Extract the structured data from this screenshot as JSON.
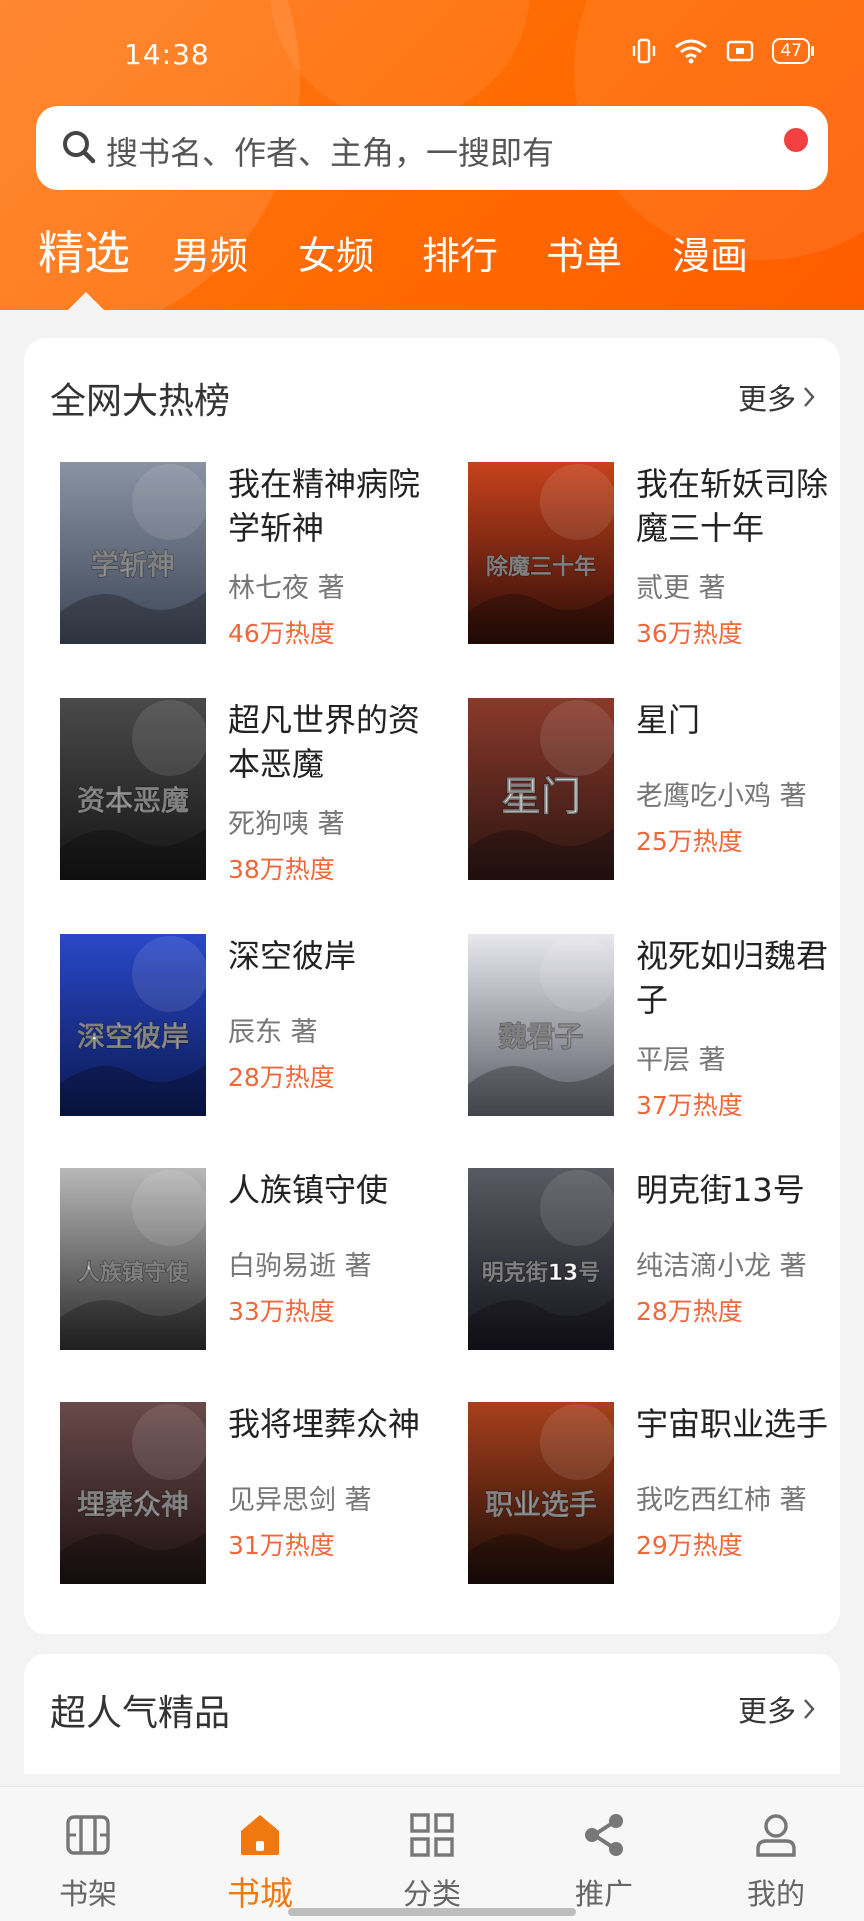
{
  "status_bar": {
    "time": "14:38",
    "battery": "47"
  },
  "search": {
    "placeholder": "搜书名、作者、主角，一搜即有"
  },
  "tabs": [
    "精选",
    "男频",
    "女频",
    "排行",
    "书单",
    "漫画"
  ],
  "active_tab": "精选",
  "hot_section": {
    "title": "全网大热榜",
    "more": "更多",
    "books": [
      {
        "title": "我在精神病院学斩神",
        "author": "林七夜 著",
        "heat": "46万热度",
        "cover_text": "学斩神",
        "cover_colors": [
          "#8a93a3",
          "#3c4656"
        ]
      },
      {
        "title": "我在斩妖司除魔三十年",
        "author": "贰更 著",
        "heat": "36万热度",
        "cover_text": "除魔三十年",
        "cover_colors": [
          "#c8421c",
          "#2a0c08"
        ]
      },
      {
        "title": "超凡世界的资本恶魔",
        "author": "死狗咦 著",
        "heat": "38万热度",
        "cover_text": "资本恶魔",
        "cover_colors": [
          "#4a4a4a",
          "#141414"
        ]
      },
      {
        "title": "星门",
        "author": "老鹰吃小鸡 著",
        "heat": "25万热度",
        "cover_text": "星门",
        "cover_colors": [
          "#8a3a2a",
          "#2a1412"
        ]
      },
      {
        "title": "深空彼岸",
        "author": "辰东 著",
        "heat": "28万热度",
        "cover_text": "深空彼岸",
        "cover_colors": [
          "#2a48c8",
          "#0a1850"
        ]
      },
      {
        "title": "视死如归魏君子",
        "author": "平层 著",
        "heat": "37万热度",
        "cover_text": "魏君子",
        "cover_colors": [
          "#e8e8ee",
          "#5a5a66"
        ]
      },
      {
        "title": "人族镇守使",
        "author": "白驹易逝 著",
        "heat": "33万热度",
        "cover_text": "人族镇守使",
        "cover_colors": [
          "#b8b8b8",
          "#2a2a2a"
        ]
      },
      {
        "title": "明克街13号",
        "author": "纯洁滴小龙 著",
        "heat": "28万热度",
        "cover_text": "明克街13号",
        "cover_colors": [
          "#5a5a64",
          "#14141c"
        ]
      },
      {
        "title": "我将埋葬众神",
        "author": "见异思剑 著",
        "heat": "31万热度",
        "cover_text": "埋葬众神",
        "cover_colors": [
          "#6a4a4a",
          "#1c1010"
        ]
      },
      {
        "title": "宇宙职业选手",
        "author": "我吃西红柿 著",
        "heat": "29万热度",
        "cover_text": "职业选手",
        "cover_colors": [
          "#a8401c",
          "#1a0c08"
        ]
      }
    ]
  },
  "popular_section": {
    "title": "超人气精品",
    "more": "更多"
  },
  "bottom_nav": [
    {
      "label": "书架",
      "icon": "bookshelf-icon"
    },
    {
      "label": "书城",
      "icon": "store-icon"
    },
    {
      "label": "分类",
      "icon": "category-icon"
    },
    {
      "label": "推广",
      "icon": "share-icon"
    },
    {
      "label": "我的",
      "icon": "profile-icon"
    }
  ],
  "active_nav": "书城",
  "colors": {
    "brand": "#ff6a00",
    "heat": "#f0673a",
    "active_nav": "#f0780f"
  }
}
